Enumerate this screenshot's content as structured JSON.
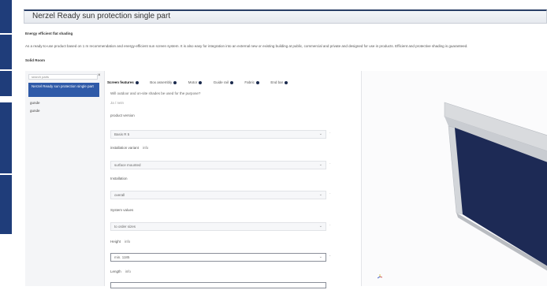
{
  "window": {
    "title": "Nerzel Ready sun protection single part"
  },
  "header": {
    "subtitle": "Energy efficient flat shading",
    "description": "As a ready-to-use product based on 1 m recommendation and energy-efficient sun screen system. It is also easy for integration into an external new or existing building at public, commercial and private and designed for use in products. Efficient and protective shading is guaranteed.",
    "section": "Solid Room"
  },
  "sidebar": {
    "search_placeholder": "search parts",
    "close": "×",
    "active_item": "Nerzel Ready sun protection single part",
    "items": [
      "gunde",
      "gunde"
    ]
  },
  "tabs": [
    {
      "label": "Screen features",
      "active": true
    },
    {
      "label": "Box assembly",
      "active": false
    },
    {
      "label": "Motor",
      "active": false
    },
    {
      "label": "Guide rail",
      "active": false
    },
    {
      "label": "Fabric",
      "active": false
    },
    {
      "label": "End bar",
      "active": false
    }
  ],
  "form": {
    "question": "Will outdoor and on-site shades be used for the purpose?",
    "answer": "Ja / nein",
    "fields": [
      {
        "label": "product version",
        "help": "",
        "value": "Basis R 5"
      },
      {
        "label": "installation variant",
        "help": "info",
        "value": "surface mounted"
      },
      {
        "label": "Installation",
        "help": "",
        "value": "overall"
      },
      {
        "label": "System values",
        "help": "",
        "value": "to order sizes"
      },
      {
        "label": "Height",
        "help": "info",
        "value": "min. 1185"
      },
      {
        "label": "Length",
        "help": "info",
        "value": ""
      }
    ]
  },
  "icons": {
    "chevron": "chevron-down-icon",
    "close": "close-icon",
    "axis": "axis-gizmo-icon"
  },
  "colors": {
    "accent": "#2f5aa8",
    "title_border": "#2a3f66",
    "panel": "#1d2a55"
  }
}
